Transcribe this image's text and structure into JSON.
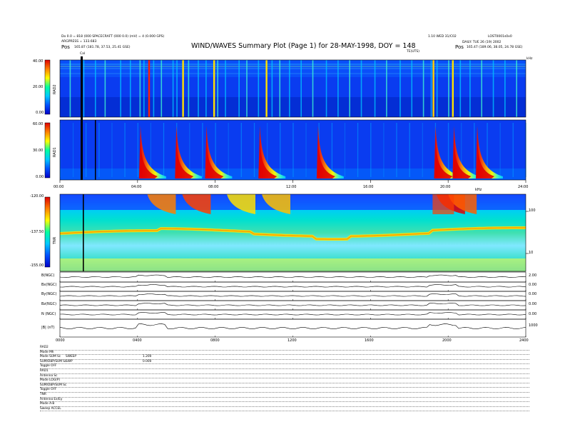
{
  "header": {
    "left_line1": "Do 0.0 = 818 (000 SPACECRAFT (000 0.0) (mV) = 4 (0.000 GPS)",
    "left_line2": "ARGPRESS = 133.683",
    "left_pos_label": "Pos",
    "left_pos_value": "165.87 (181.78, 37.53, 25.41 GSE)",
    "title": "WIND/WAVES Summary Plot (Page 1) for 28-MAY-1998, DOY = 148",
    "right_line1a": "1.10 WED 31/C02",
    "right_line1b": "LOST0001s0x0",
    "right_line2": "DAILY: TUE 26 (19) 2002",
    "right_pos_label": "Pos",
    "right_pos_value": "165.47 (189.06, 38.05, 24.78 GSE)",
    "cal_label": "Cal",
    "tnr_top_label": "TE(UTS)"
  },
  "chart_data": [
    {
      "type": "heatmap",
      "name": "RAD2",
      "title": "",
      "ylabel": "RAD2",
      "y_ticks": [
        "40.00",
        "20.00",
        "0.00"
      ],
      "right_tick": "kHz",
      "x_range_hours": [
        0,
        24
      ],
      "colorbar": [
        "#0000c8",
        "#0050ff",
        "#00c8ff",
        "#00ffa0",
        "#ffff00",
        "#ff8000",
        "#e00000"
      ],
      "background": "#0a3cf0",
      "vertical_streaks_hours": [
        0.5,
        1.2,
        1.8,
        2.3,
        3.1,
        3.6,
        4.1,
        4.3,
        4.8,
        5.2,
        5.8,
        6.0,
        6.6,
        7.1,
        7.5,
        8.1,
        8.5,
        9.2,
        9.6,
        10.2,
        10.9,
        11.3,
        11.8,
        12.4,
        13.0,
        13.7,
        14.3,
        14.9,
        15.5,
        16.2,
        16.8,
        17.5,
        18.1,
        18.7,
        19.1,
        19.4,
        20.0,
        20.6,
        21.1,
        21.7,
        22.3,
        22.9,
        23.5
      ]
    },
    {
      "type": "heatmap",
      "name": "RAD1",
      "ylabel": "RAD1",
      "y_ticks": [
        "60.00",
        "30.00",
        "0.00"
      ],
      "x_ticks": [
        "00:00",
        "04:00",
        "08:00",
        "12:00",
        "16:00",
        "20:00",
        "24:00"
      ],
      "x_range_hours": [
        0,
        24
      ],
      "colorbar": [
        "#0000c8",
        "#0050ff",
        "#00c8ff",
        "#00ffa0",
        "#ffff00",
        "#ff8000",
        "#e00000"
      ],
      "bursts_hours": [
        4.15,
        6.0,
        7.55,
        10.3,
        13.3,
        19.35,
        20.3,
        21.5
      ]
    },
    {
      "type": "heatmap",
      "name": "TNR",
      "ylabel": "TNR",
      "y_ticks": [
        "-120.00",
        "-137.50",
        "-155.00"
      ],
      "right_ticks": [
        "100",
        "10"
      ],
      "right_top": "kHz",
      "x_range_hours": [
        0,
        24
      ],
      "colorbar": [
        "#0000c8",
        "#0050ff",
        "#00c8ff",
        "#00ffa0",
        "#ffff00",
        "#ff8000",
        "#e00000"
      ]
    },
    {
      "type": "line",
      "name": "magnetometer",
      "rows": [
        {
          "label": "B(NGC)",
          "right": "2.00"
        },
        {
          "label": "Bx(NGC)",
          "right": "0.00"
        },
        {
          "label": "By(NGC)",
          "right": "0.00"
        },
        {
          "label": "Bz(NGC)",
          "right": "0.00"
        },
        {
          "label": "N (NGC)",
          "right": "0.00"
        },
        {
          "label": "|B| (nT)",
          "right": "1000"
        }
      ],
      "x_ticks": [
        "0000",
        "0400",
        "0800",
        "1200",
        "1600",
        "2000",
        "2400"
      ]
    }
  ],
  "footer": {
    "rows": [
      {
        "label": "RAD2",
        "a": "",
        "b": ""
      },
      {
        "label": "Mode      Mh",
        "a": "",
        "b": ""
      },
      {
        "label": "Mode   SUM  Sc",
        "a": "SWEEP",
        "b": "1.200"
      },
      {
        "label": "SUM/DBP/SUM  Sc",
        "a": "SWP",
        "b": "0.000"
      },
      {
        "label": "Toggle     OFF",
        "a": "",
        "b": ""
      },
      {
        "label": "RAD1",
        "a": "",
        "b": ""
      },
      {
        "label": "Antenna    Sc",
        "a": "",
        "b": ""
      },
      {
        "label": "Mode  LOG(P)",
        "a": "",
        "b": ""
      },
      {
        "label": "SUM/DBP/SUM  Sc",
        "a": "",
        "b": ""
      },
      {
        "label": "Toggle     OFF",
        "a": "",
        "b": ""
      },
      {
        "label": "TNR",
        "a": "",
        "b": ""
      },
      {
        "label": "Antenna   Ex/Ey",
        "a": "",
        "b": ""
      },
      {
        "label": "Mode     A-B",
        "a": "",
        "b": ""
      },
      {
        "label": "Sweep  ACCEL",
        "a": "",
        "b": ""
      }
    ]
  }
}
